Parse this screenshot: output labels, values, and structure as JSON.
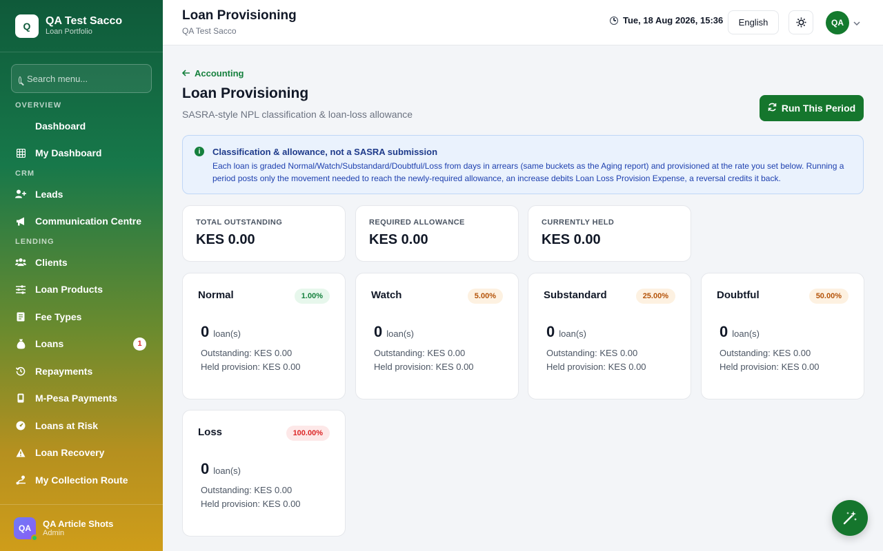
{
  "brand": {
    "logo_letter": "Q",
    "title": "QA Test Sacco",
    "subtitle": "Loan Portfolio"
  },
  "search": {
    "placeholder": "Search menu..."
  },
  "sidebar": {
    "sections": [
      {
        "label": "OVERVIEW",
        "items": [
          {
            "label": "Dashboard",
            "icon": "none"
          },
          {
            "label": "My Dashboard",
            "icon": "grid-icon"
          }
        ]
      },
      {
        "label": "CRM",
        "items": [
          {
            "label": "Leads",
            "icon": "user-plus-icon"
          },
          {
            "label": "Communication Centre",
            "icon": "megaphone-icon"
          }
        ]
      },
      {
        "label": "LENDING",
        "items": [
          {
            "label": "Clients",
            "icon": "users-icon"
          },
          {
            "label": "Loan Products",
            "icon": "sliders-icon"
          },
          {
            "label": "Fee Types",
            "icon": "receipt-icon"
          },
          {
            "label": "Loans",
            "icon": "money-bag-icon",
            "badge": "1"
          },
          {
            "label": "Repayments",
            "icon": "history-icon"
          },
          {
            "label": "M-Pesa Payments",
            "icon": "phone-icon"
          },
          {
            "label": "Loans at Risk",
            "icon": "gauge-icon"
          },
          {
            "label": "Loan Recovery",
            "icon": "warning-icon"
          },
          {
            "label": "My Collection Route",
            "icon": "route-icon"
          }
        ]
      }
    ]
  },
  "user": {
    "initials": "QA",
    "name": "QA Article Shots",
    "role": "Admin"
  },
  "topbar": {
    "title": "Loan Provisioning",
    "subtitle": "QA Test Sacco",
    "datetime": "Tue, 18 Aug 2026, 15:36",
    "language": "English",
    "avatar": "QA"
  },
  "page": {
    "back_label": "Accounting",
    "title": "Loan Provisioning",
    "subtitle": "SASRA-style NPL classification & loan-loss allowance",
    "run_button": "Run This Period"
  },
  "info": {
    "title": "Classification & allowance, not a SASRA submission",
    "body": "Each loan is graded Normal/Watch/Substandard/Doubtful/Loss from days in arrears (same buckets as the Aging report) and provisioned at the rate you set below. Running a period posts only the movement needed to reach the newly-required allowance, an increase debits Loan Loss Provision Expense, a reversal credits it back."
  },
  "summary": [
    {
      "label": "TOTAL OUTSTANDING",
      "value": "KES 0.00"
    },
    {
      "label": "REQUIRED ALLOWANCE",
      "value": "KES 0.00"
    },
    {
      "label": "CURRENTLY HELD",
      "value": "KES 0.00"
    }
  ],
  "classes": [
    {
      "name": "Normal",
      "rate": "1.00%",
      "count": "0",
      "unit": "loan(s)",
      "outstanding": "Outstanding: KES 0.00",
      "held": "Held provision: KES 0.00",
      "rate_color": "#15803d"
    },
    {
      "name": "Watch",
      "rate": "5.00%",
      "count": "0",
      "unit": "loan(s)",
      "outstanding": "Outstanding: KES 0.00",
      "held": "Held provision: KES 0.00",
      "rate_color": "#b45309"
    },
    {
      "name": "Substandard",
      "rate": "25.00%",
      "count": "0",
      "unit": "loan(s)",
      "outstanding": "Outstanding: KES 0.00",
      "held": "Held provision: KES 0.00",
      "rate_color": "#b45309"
    },
    {
      "name": "Doubtful",
      "rate": "50.00%",
      "count": "0",
      "unit": "loan(s)",
      "outstanding": "Outstanding: KES 0.00",
      "held": "Held provision: KES 0.00",
      "rate_color": "#b45309"
    },
    {
      "name": "Loss",
      "rate": "100.00%",
      "count": "0",
      "unit": "loan(s)",
      "outstanding": "Outstanding: KES 0.00",
      "held": "Held provision: KES 0.00",
      "rate_color": "#dc2626"
    }
  ],
  "colors": {
    "primary": "#15762d",
    "info_bg": "#eaf2fd",
    "info_text": "#1e40af"
  },
  "fab": {
    "icon": "magic-wand-icon"
  }
}
